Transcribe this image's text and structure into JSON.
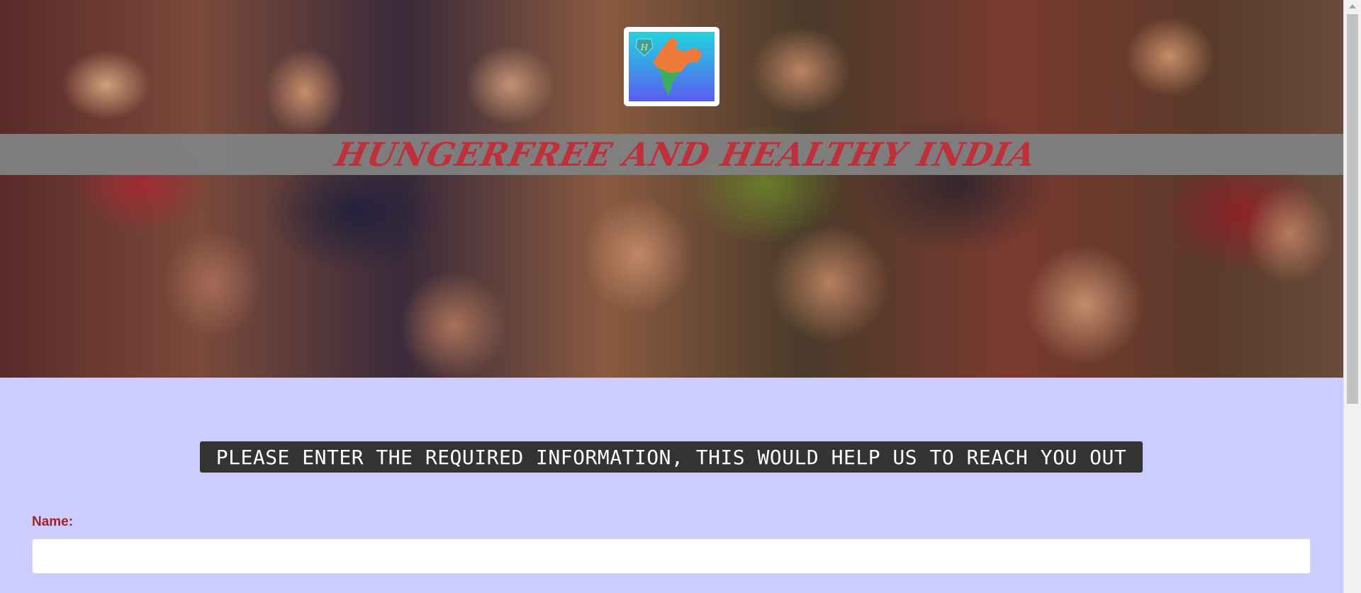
{
  "header": {
    "title": "HUNGERFREE AND HEALTHY INDIA",
    "logo_icon": "india-map-logo-icon",
    "logo_letter": "H",
    "banner_image": "children-celebrating-photo"
  },
  "form": {
    "notice": "PLEASE ENTER THE REQUIRED INFORMATION, THIS WOULD HELP US TO REACH YOU OUT",
    "name_label": "Name:",
    "name_value": ""
  },
  "colors": {
    "page_background": "#ccccff",
    "title_color": "#c0303a",
    "title_band": "#808080",
    "notice_background": "#333333",
    "label_color": "#a0242c"
  }
}
